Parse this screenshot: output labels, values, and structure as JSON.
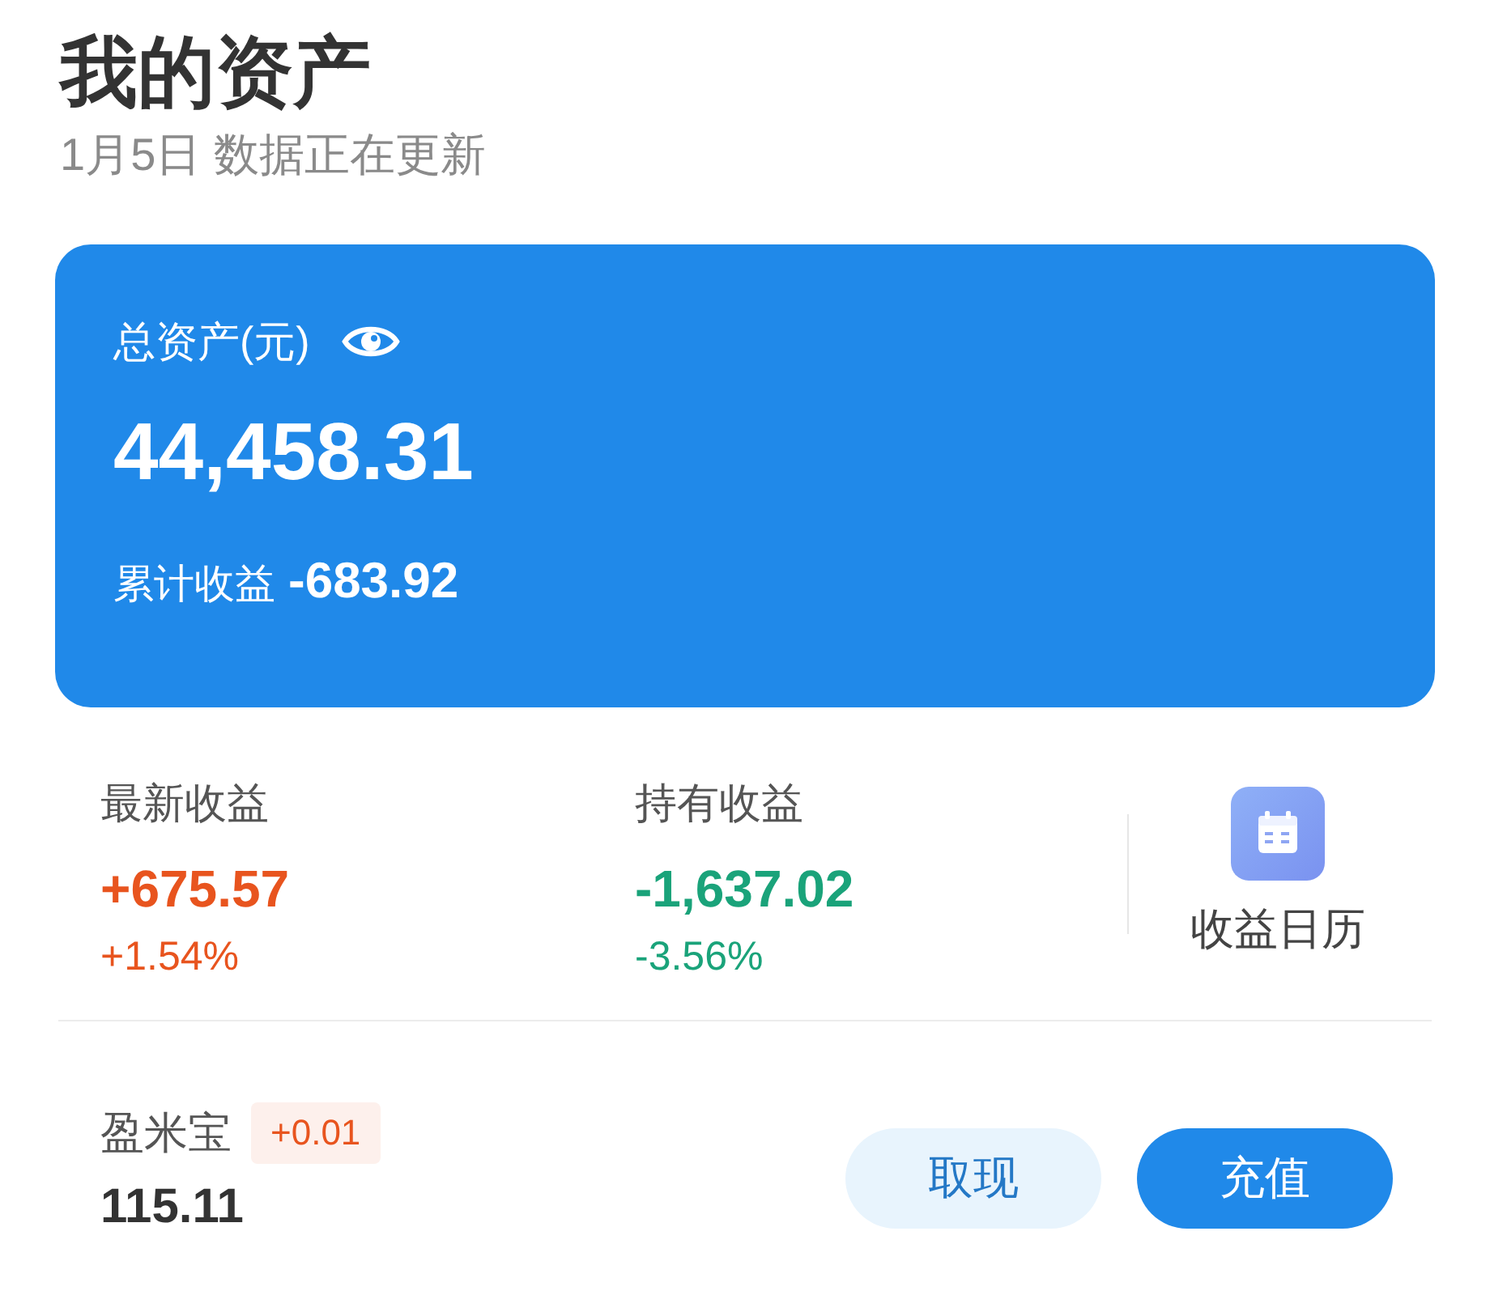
{
  "header": {
    "title": "我的资产",
    "subtitle": "1月5日 数据正在更新"
  },
  "asset_card": {
    "label": "总资产(元)",
    "total": "44,458.31",
    "cumulative_label": "累计收益",
    "cumulative_value": "-683.92"
  },
  "stats": [
    {
      "label": "最新收益",
      "value": "+675.57",
      "percent": "+1.54%",
      "color": "#e8541e"
    },
    {
      "label": "持有收益",
      "value": "-1,637.02",
      "percent": "-3.56%",
      "color": "#1aa37a"
    }
  ],
  "calendar_link": {
    "label": "收益日历"
  },
  "fund": {
    "name": "盈米宝",
    "change": "+0.01",
    "amount": "115.11"
  },
  "buttons": [
    {
      "label": "取现",
      "kind": "secondary"
    },
    {
      "label": "充值",
      "kind": "primary"
    }
  ]
}
